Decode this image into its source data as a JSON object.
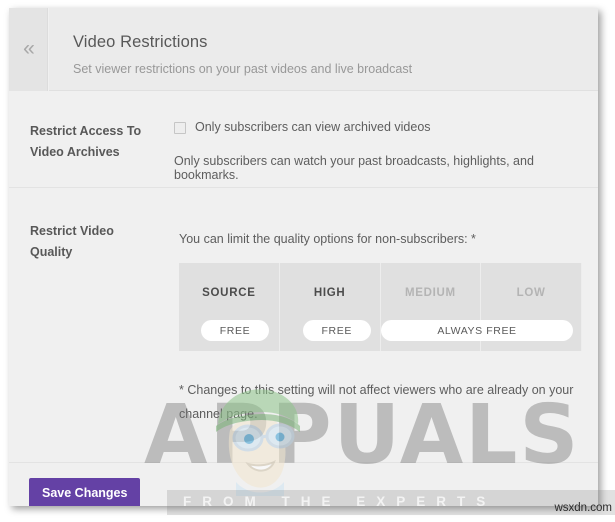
{
  "panel": {
    "collapse_icon": "double-chevron-left-icon",
    "collapse_glyph": "«",
    "header": {
      "title": "Video Restrictions",
      "subtitle": "Set viewer restrictions on your past videos and live broadcast"
    },
    "sections": [
      {
        "label": "Restrict Access To Video Archives",
        "label_line1": "Restrict Access To",
        "label_line2": "Video Archives",
        "checkbox": {
          "label": "Only subscribers can view archived videos",
          "checked": false
        },
        "help_text": "Only subscribers can watch your past broadcasts, highlights, and bookmarks."
      },
      {
        "label": "Restrict Video Quality",
        "label_line1": "Restrict Video",
        "label_line2": "Quality",
        "intro": "You can limit the quality options for non-subscribers: *",
        "note": "* Changes to this setting will not affect viewers who are already on your channel page."
      }
    ],
    "quality_grid": {
      "columns": [
        {
          "title": "SOURCE",
          "dimmed": false,
          "pill": "FREE"
        },
        {
          "title": "HIGH",
          "dimmed": false,
          "pill": "FREE"
        },
        {
          "title": "MEDIUM",
          "dimmed": true,
          "pill": null
        },
        {
          "title": "LOW",
          "dimmed": true,
          "pill": null
        }
      ],
      "merged_pill": "ALWAYS FREE"
    },
    "footer": {
      "save_label": "Save Changes",
      "save_color": "#6441a5"
    }
  },
  "watermark": {
    "wordmark": "APPUALS",
    "tagline": "FROM THE EXPERTS",
    "credit": "wsxdn.com"
  }
}
